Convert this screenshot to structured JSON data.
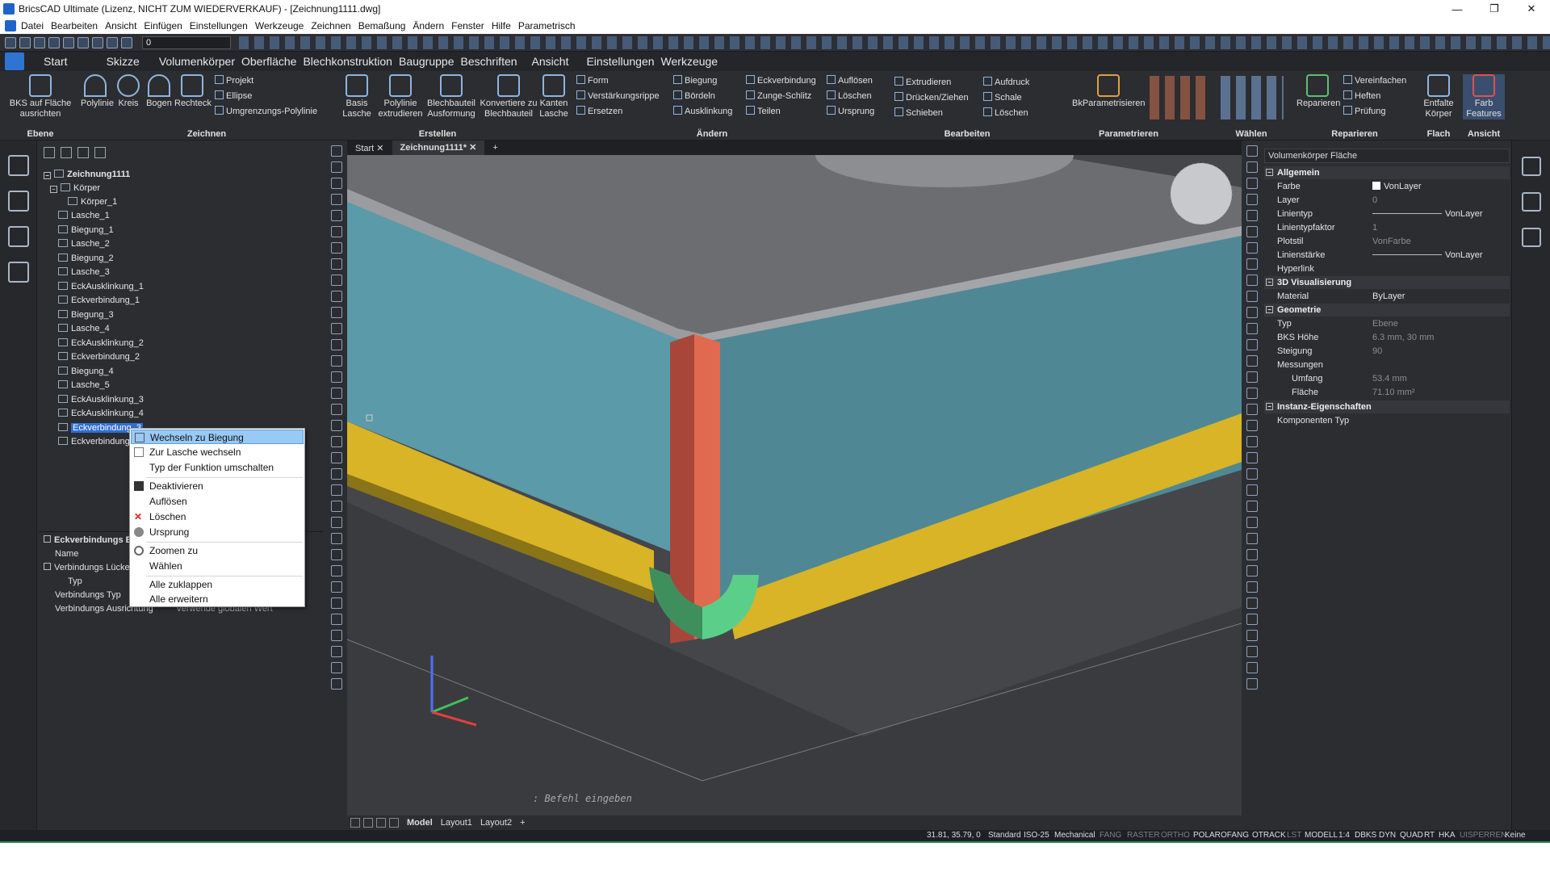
{
  "titlebar": {
    "title": "BricsCAD Ultimate (Lizenz, NICHT ZUM WIEDERVERKAUF) - [Zeichnung1111.dwg]",
    "min": "—",
    "max": "❐",
    "close": "✕"
  },
  "menubar": {
    "items": [
      "Datei",
      "Bearbeiten",
      "Ansicht",
      "Einfügen",
      "Einstellungen",
      "Werkzeuge",
      "Zeichnen",
      "Bemaßung",
      "Ändern",
      "Fenster",
      "Hilfe",
      "Parametrisch"
    ]
  },
  "qat": {
    "layer": "0"
  },
  "ribbon_tabs": [
    "Start",
    "Skizze",
    "Volumenkörper",
    "Oberfläche",
    "Blechkonstruktion",
    "Baugruppe",
    "Beschriften",
    "Ansicht",
    "Einstellungen",
    "Werkzeuge"
  ],
  "ribbon": {
    "ebene": {
      "title": "Ebene",
      "btn": "BKS auf Fläche ausrichten"
    },
    "zeichnen": {
      "title": "Zeichnen",
      "polylinie": "Polylinie",
      "kreis": "Kreis",
      "bogen": "Bogen",
      "rechteck": "Rechteck",
      "projekt": "Projekt",
      "ellipse": "Ellipse",
      "umgrenzung": "Umgrenzungs-Polylinie"
    },
    "erstellen": {
      "title": "Erstellen",
      "basis": "Basis Lasche",
      "polyextr": "Polylinie extrudieren",
      "blechaus": "Blechbauteil Ausformung",
      "konvert": "Konvertiere zu Blechbauteil"
    },
    "aendern": {
      "title": "Ändern",
      "kanten": "Kanten Lasche",
      "form": "Form",
      "verstaerkung": "Verstärkungsrippe",
      "ersetzen": "Ersetzen",
      "biegung": "Biegung",
      "boerdeln": "Bördeln",
      "ausklinkung": "Ausklinkung",
      "eckverbindung": "Eckverbindung",
      "zunge": "Zunge-Schlitz",
      "teilen": "Teilen",
      "aufloesen": "Auflösen",
      "loeschen": "Löschen",
      "ursprung": "Ursprung"
    },
    "bearbeiten": {
      "title": "Bearbeiten",
      "extrudieren": "Extrudieren",
      "druecken": "Drücken/Ziehen",
      "schieben": "Schieben",
      "aufdruck": "Aufdruck",
      "schale": "Schale",
      "loeschen": "Löschen"
    },
    "parametrieren": {
      "title": "Parametrieren",
      "bk": "BkParametrisieren"
    },
    "waehlen": {
      "title": "Wählen"
    },
    "reparieren": {
      "title": "Reparieren",
      "reparieren": "Reparieren",
      "vereinfachen": "Vereinfachen",
      "heften": "Heften",
      "pruefung": "Prüfung"
    },
    "flach": {
      "title": "Flach",
      "entfalte": "Entfalte Körper"
    },
    "ansicht": {
      "title": "Ansicht",
      "farb": "Farb Features"
    }
  },
  "tree": {
    "root": "Zeichnung1111",
    "koerper": "Körper",
    "koerper1": "Körper_1",
    "items": [
      "Lasche_1",
      "Biegung_1",
      "Lasche_2",
      "Biegung_2",
      "Lasche_3",
      "EckAusklinkung_1",
      "Eckverbindung_1",
      "Biegung_3",
      "Lasche_4",
      "EckAusklinkung_2",
      "Eckverbindung_2",
      "Biegung_4",
      "Lasche_5",
      "EckAusklinkung_3",
      "EckAusklinkung_4",
      "Eckverbindung_3",
      "Eckverbindung_4"
    ]
  },
  "leftprops": {
    "section": "Eckverbindungs E",
    "name": "Name",
    "verbindung_luecke": "Verbindungs Lücke",
    "typ": "Typ",
    "verbindung_typ": "Verbindungs Typ",
    "verbindung_ausrichtung": "Verbindungs Ausrichtung",
    "verbindung_ausrichtung_val": "Verwende globalen Wert"
  },
  "context_menu": {
    "items": [
      {
        "label": "Wechseln zu Biegung",
        "icon": "bend-icon"
      },
      {
        "label": "Zur Lasche wechseln",
        "icon": "flange-icon"
      },
      {
        "label": "Typ der Funktion umschalten",
        "icon": ""
      },
      {
        "label": "Deaktivieren",
        "icon": "disable-icon"
      },
      {
        "label": "Auflösen",
        "icon": ""
      },
      {
        "label": "Löschen",
        "icon": "delete-icon"
      },
      {
        "label": "Ursprung",
        "icon": "origin-icon"
      },
      {
        "label": "Zoomen zu",
        "icon": "zoom-icon"
      },
      {
        "label": "Wählen",
        "icon": ""
      },
      {
        "label": "Alle zuklappen",
        "icon": ""
      },
      {
        "label": "Alle erweitern",
        "icon": ""
      }
    ]
  },
  "doc_tabs": {
    "start": "Start",
    "drawing": "Zeichnung1111*",
    "plus": "+"
  },
  "command": {
    "prompt": ": Befehl eingeben"
  },
  "layout_tabs": [
    "Model",
    "Layout1",
    "Layout2",
    "+"
  ],
  "properties": {
    "header": "Volumenkörper Fläche",
    "allgemein": "Allgemein",
    "rows_allg": [
      {
        "k": "Farbe",
        "v": "VonLayer"
      },
      {
        "k": "Layer",
        "v": "0"
      },
      {
        "k": "Linientyp",
        "v": "VonLayer"
      },
      {
        "k": "Linientypfaktor",
        "v": "1"
      },
      {
        "k": "Plotstil",
        "v": "VonFarbe"
      },
      {
        "k": "Linienstärke",
        "v": "VonLayer"
      },
      {
        "k": "Hyperlink",
        "v": ""
      }
    ],
    "vis3d": "3D Visualisierung",
    "material_k": "Material",
    "material_v": "ByLayer",
    "geometrie": "Geometrie",
    "typ_k": "Typ",
    "typ_v": "Ebene",
    "bks_k": "BKS Höhe",
    "bks_v": "6.3 mm, 30 mm",
    "steigung_k": "Steigung",
    "steigung_v": "90",
    "messungen": "Messungen",
    "umfang_k": "Umfang",
    "umfang_v": "53.4 mm",
    "flaeche_k": "Fläche",
    "flaeche_v": "71.10 mm²",
    "instanz": "Instanz-Eigenschaften",
    "komp_typ": "Komponenten Typ"
  },
  "statusbar": {
    "coords": "31.81, 35.79, 0",
    "items_on": [
      "Standard",
      "ISO-25",
      "Mechanical",
      "POLAR",
      "OFANG",
      "OTRACK",
      "MODELL",
      "1:4",
      "DBKS",
      "DYN",
      "QUAD",
      "RT",
      "HKA",
      "Keine"
    ],
    "items_off": [
      "FANG",
      "RASTER",
      "ORTHO",
      "LST",
      "UISPERREN"
    ]
  },
  "colors": {
    "accent": "#2f6fd4",
    "panel": "#2b2d31",
    "wall": "#5b9fae",
    "corner_red": "#d9604a",
    "bend_yellow": "#c9a522",
    "corner_green": "#4db877"
  }
}
